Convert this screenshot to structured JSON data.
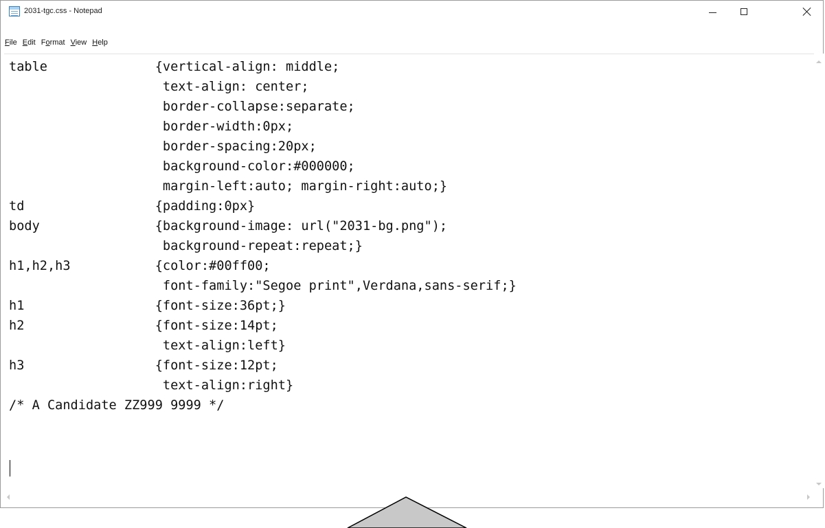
{
  "window": {
    "title": "2031-tgc.css - Notepad"
  },
  "icons": {
    "app": "notepad-icon",
    "minimize": "minimize-icon",
    "maximize": "maximize-icon",
    "close": "close-icon"
  },
  "menu": {
    "items": [
      {
        "accel": "F",
        "rest": "ile"
      },
      {
        "accel": "E",
        "rest": "dit"
      },
      {
        "pre": "F",
        "accel": "o",
        "rest": "rmat"
      },
      {
        "accel": "V",
        "rest": "iew"
      },
      {
        "accel": "H",
        "rest": "elp"
      }
    ]
  },
  "editor": {
    "content": "table              {vertical-align: middle;\n                    text-align: center;\n                    border-collapse:separate;\n                    border-width:0px;\n                    border-spacing:20px;\n                    background-color:#000000;\n                    margin-left:auto; margin-right:auto;}\ntd                 {padding:0px}\nbody               {background-image: url(\"2031-bg.png\");\n                    background-repeat:repeat;}\nh1,h2,h3           {color:#00ff00;\n                    font-family:\"Segoe print\",Verdana,sans-serif;}\nh1                 {font-size:36pt;}\nh2                 {font-size:14pt;\n                    text-align:left}\nh3                 {font-size:12pt;\n                    text-align:right}\n/* A Candidate ZZ999 9999 */"
  },
  "colors": {
    "window_border": "#9a9a9a",
    "text": "#111111",
    "overlay_fill": "#c8c8c8",
    "overlay_stroke": "#000000"
  }
}
